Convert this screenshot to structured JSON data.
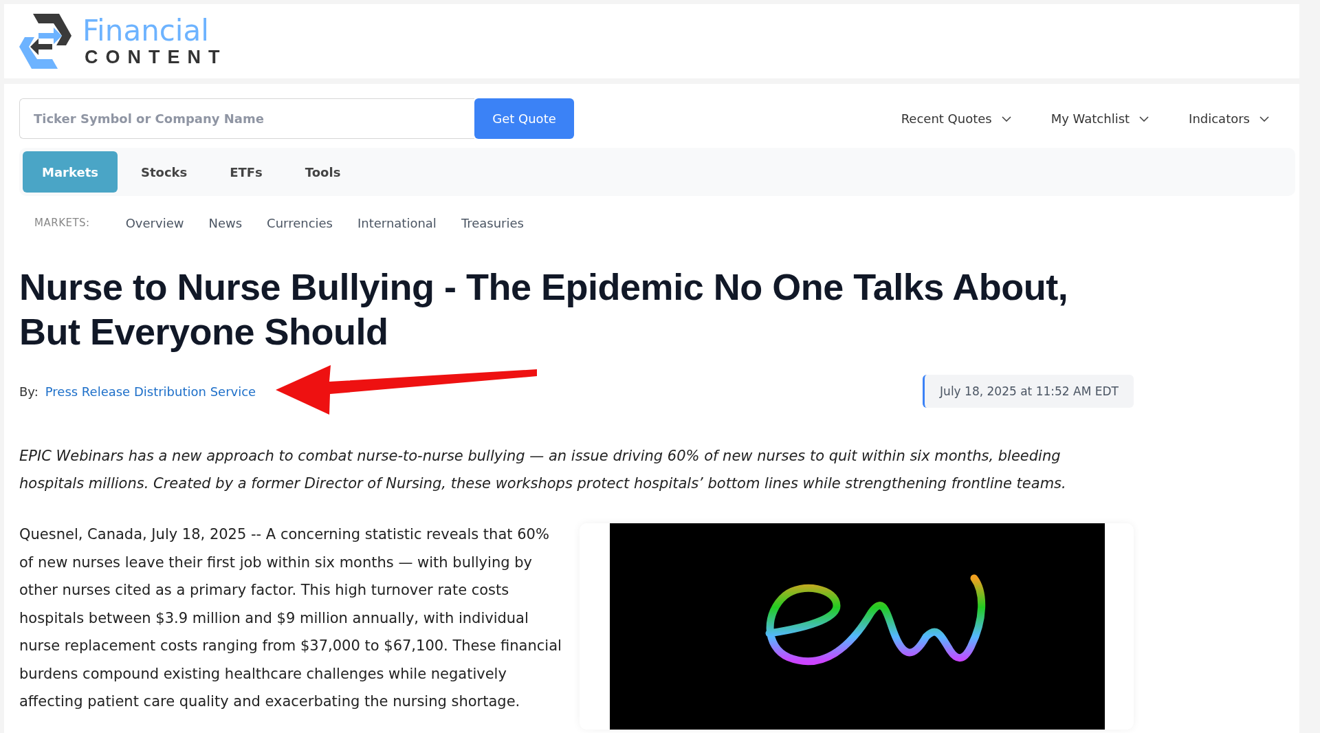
{
  "logo": {
    "line_1": "Financial",
    "line_2": "CONTENT"
  },
  "search": {
    "placeholder": "Ticker Symbol or Company Name",
    "button": "Get Quote"
  },
  "top_menu": [
    {
      "label": "Recent Quotes"
    },
    {
      "label": "My Watchlist"
    },
    {
      "label": "Indicators"
    }
  ],
  "tabs": [
    {
      "label": "Markets",
      "selected": true
    },
    {
      "label": "Stocks",
      "selected": false
    },
    {
      "label": "ETFs",
      "selected": false
    },
    {
      "label": "Tools",
      "selected": false
    }
  ],
  "sub_nav": {
    "label": "MARKETS:",
    "items": [
      "Overview",
      "News",
      "Currencies",
      "International",
      "Treasuries"
    ]
  },
  "article": {
    "title": "Nurse to Nurse Bullying - The Epidemic No One Talks About, But Everyone Should",
    "byline_label": "By:",
    "author": "Press Release Distribution Service",
    "date": "July 18, 2025 at 11:52 AM EDT",
    "summary": "EPIC Webinars has a new approach to combat nurse-to-nurse bullying — an issue driving 60% of new nurses to quit within six months, bleeding hospitals millions. Created by a former Director of Nursing, these workshops protect hospitals’ bottom lines while strengthening frontline teams.",
    "body": "Quesnel, Canada, July 18, 2025 -- A concerning statistic reveals that 60% of new nurses leave their first job within six months — with bullying by other nurses cited as a primary factor. This high turnover rate costs hospitals between $3.9 million and $9 million annually, with individual nurse replacement costs ranging from $37,000 to $67,100. These financial burdens compound existing healthcare challenges while negatively affecting patient care quality and exacerbating the nursing shortage."
  }
}
